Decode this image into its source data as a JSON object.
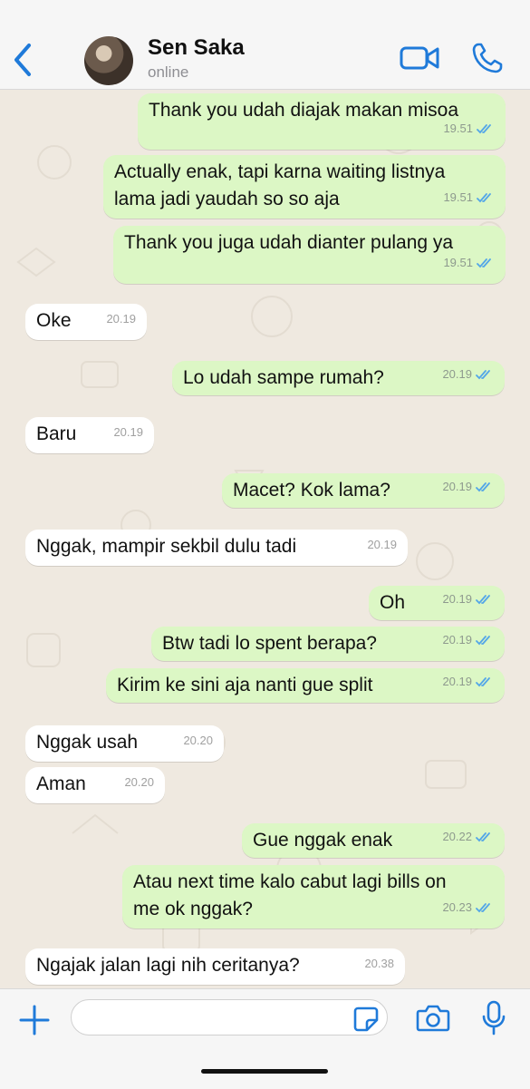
{
  "header": {
    "back_icon": "chevron-left-icon",
    "contact_name": "Sen Saka",
    "status": "online",
    "video_icon": "video-camera-icon",
    "call_icon": "phone-icon",
    "accent_color": "#1f7ad9"
  },
  "messages": [
    {
      "direction": "out",
      "text": [
        "Thank you udah diajak makan misoa"
      ],
      "time": "19.51",
      "read": true
    },
    {
      "direction": "out",
      "text": [
        "Actually enak, tapi karna waiting listnya",
        "lama jadi yaudah so so aja"
      ],
      "time": "19.51",
      "read": true
    },
    {
      "direction": "out",
      "text": [
        "Thank you juga udah dianter pulang ya"
      ],
      "time": "19.51",
      "read": true
    },
    {
      "direction": "in",
      "text": [
        "Oke"
      ],
      "time": "20.19"
    },
    {
      "direction": "out",
      "text": [
        "Lo udah sampe rumah?"
      ],
      "time": "20.19",
      "read": true
    },
    {
      "direction": "in",
      "text": [
        "Baru"
      ],
      "time": "20.19"
    },
    {
      "direction": "out",
      "text": [
        "Macet? Kok lama?"
      ],
      "time": "20.19",
      "read": true
    },
    {
      "direction": "in",
      "text": [
        "Nggak, mampir sekbil dulu tadi"
      ],
      "time": "20.19"
    },
    {
      "direction": "out",
      "text": [
        "Oh"
      ],
      "time": "20.19",
      "read": true
    },
    {
      "direction": "out",
      "text": [
        "Btw tadi lo spent berapa?"
      ],
      "time": "20.19",
      "read": true
    },
    {
      "direction": "out",
      "text": [
        "Kirim ke sini aja nanti gue split"
      ],
      "time": "20.19",
      "read": true
    },
    {
      "direction": "in",
      "text": [
        "Nggak usah"
      ],
      "time": "20.20"
    },
    {
      "direction": "in",
      "text": [
        "Aman"
      ],
      "time": "20.20"
    },
    {
      "direction": "out",
      "text": [
        "Gue nggak enak"
      ],
      "time": "20.22",
      "read": true
    },
    {
      "direction": "out",
      "text": [
        "Atau next time kalo cabut lagi bills on",
        "me ok nggak?"
      ],
      "time": "20.23",
      "read": true
    },
    {
      "direction": "in",
      "text": [
        "Ngajak jalan lagi nih ceritanya?"
      ],
      "time": "20.38"
    }
  ],
  "colors": {
    "outgoing_bubble": "#dcf7c5",
    "incoming_bubble": "#ffffff",
    "chat_background": "#efe9e0",
    "read_ticks": "#53a6e8"
  },
  "composer": {
    "plus_icon": "plus-icon",
    "input_value": "",
    "sticker_icon": "sticker-icon",
    "camera_icon": "camera-icon",
    "mic_icon": "microphone-icon"
  }
}
